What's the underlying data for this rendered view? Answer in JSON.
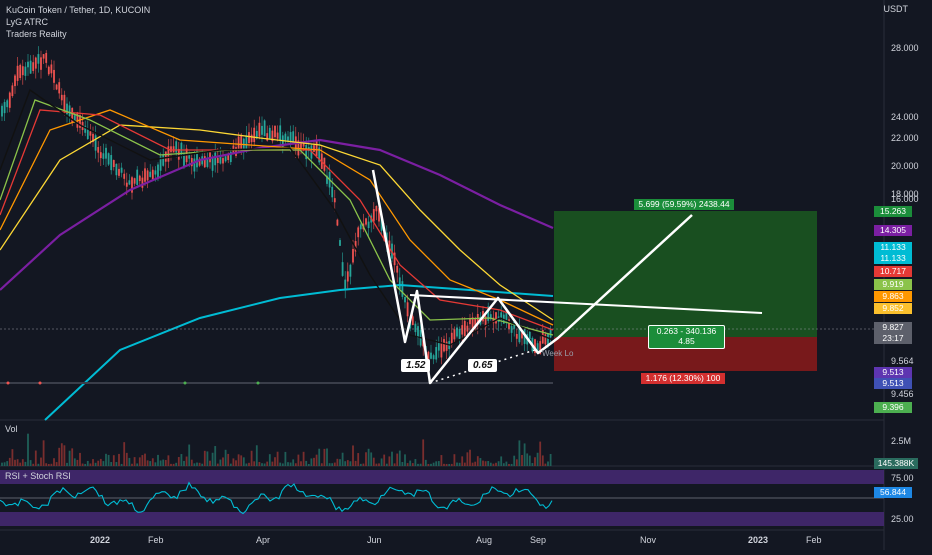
{
  "legend": {
    "title": "KuCoin Token / Tether, 1D, KUCOIN",
    "indicators": [
      "LyG ATRC",
      "Traders Reality"
    ]
  },
  "volume_label": "Vol",
  "rsi_label": "RSI + Stoch RSI",
  "currency": "USDT",
  "price_axis_ticks": [
    "28.000",
    "24.000",
    "22.000",
    "20.000",
    "18.000",
    "16.000",
    "9.564",
    "9.456"
  ],
  "price_badges": [
    {
      "value": "15.263",
      "color": "#1b8d3a"
    },
    {
      "value": "14.305",
      "color": "#7b1fa2"
    },
    {
      "value": "11.133",
      "color": "#00bcd4"
    },
    {
      "value": "11.133",
      "color": "#00bcd4"
    },
    {
      "value": "10.717",
      "color": "#e53935"
    },
    {
      "value": "9.919",
      "color": "#8bc34a"
    },
    {
      "value": "9.863",
      "color": "#ff9800"
    },
    {
      "value": "9.852",
      "color": "#fbc02d"
    },
    {
      "value": "9.827",
      "color": "#5d606b"
    },
    {
      "value": "23:17",
      "color": "#5d606b"
    },
    {
      "value": "9.513",
      "color": "#5e35b1"
    },
    {
      "value": "9.513",
      "color": "#3f51b5"
    },
    {
      "value": "9.396",
      "color": "#4caf50"
    }
  ],
  "volume_axis": {
    "tick": "2.5M",
    "badge": "145.388K"
  },
  "rsi_axis": {
    "ticks": [
      "75.00",
      "25.00"
    ],
    "badge": "56.844"
  },
  "time_axis": [
    "2022",
    "Feb",
    "Apr",
    "Jun",
    "Aug",
    "Sep",
    "Nov",
    "2023",
    "Feb"
  ],
  "position_tool": {
    "target_label": "5.699 (59.59%) 2438.44",
    "center_label_line1": "0.263 - 340.136",
    "center_label_line2": "4.85",
    "stop_label": "1.176 (12.30%) 100"
  },
  "pattern_ratios": [
    "1.52",
    "0.65"
  ],
  "overlay_texts": [
    "Week Lo"
  ],
  "colors": {
    "background": "#131722",
    "up_candle": "#26a69a",
    "down_candle": "#ef5350",
    "target_zone": "#1b5e20",
    "stop_zone": "#8b1a1a",
    "ma_200": "#7b1fa2",
    "ma_cyan": "#00bcd4",
    "ma_yellow": "#fdd835",
    "ma_orange": "#ff9800",
    "ma_red": "#e53935",
    "ma_green": "#8bc34a",
    "ma_black": "#111111"
  }
}
